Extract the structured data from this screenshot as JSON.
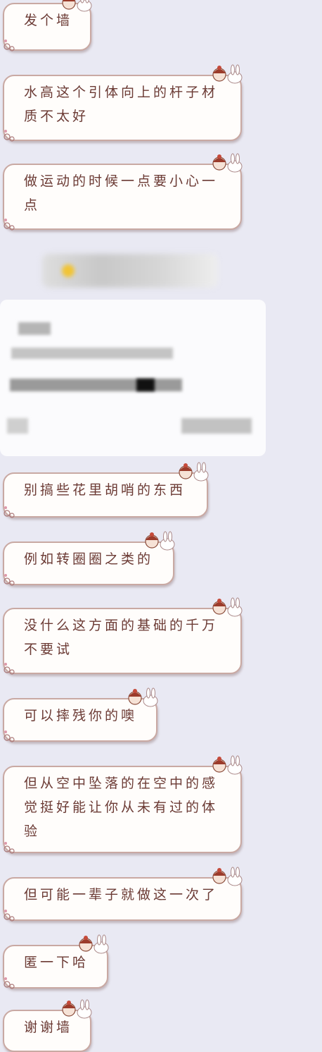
{
  "messages": [
    {
      "text": "发个墙"
    },
    {
      "text": "水高这个引体向上的杆子材质不太好"
    },
    {
      "text": "做运动的时候一点要小心一点"
    },
    {
      "text": "别搞些花里胡哨的东西"
    },
    {
      "text": "例如转圈圈之类的"
    },
    {
      "text": "没什么这方面的基础的千万不要试"
    },
    {
      "text": "可以摔残你的噢"
    },
    {
      "text": "但从空中坠落的在空中的感觉挺好能让你从未有过的体验"
    },
    {
      "text": "但可能一辈子就做这一次了"
    },
    {
      "text": "匿一下哈"
    },
    {
      "text": "谢谢墙"
    }
  ],
  "colors": {
    "background": "#e9e9f3",
    "bubble_fill": "#fffdfb",
    "bubble_border": "#c9a9a3",
    "text": "#6b3a34"
  },
  "icons": [
    "girl-bunny-sticker-icon",
    "flower-corner-icon"
  ]
}
